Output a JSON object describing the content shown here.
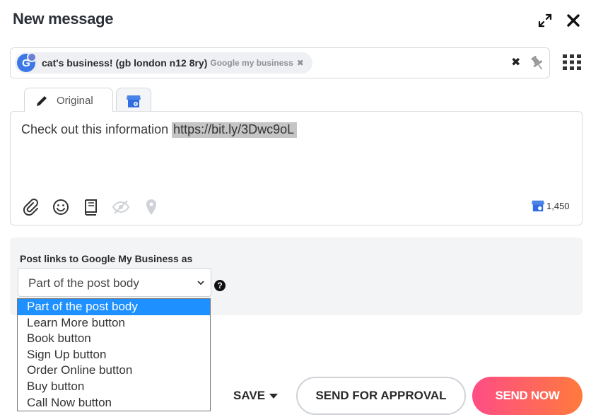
{
  "header": {
    "title": "New message",
    "icons": [
      "expand-icon",
      "close-icon"
    ]
  },
  "recipients": {
    "chips": [
      {
        "avatar_letter": "G",
        "name": "cat's business! (gb london n12 8ry)",
        "type": "Google my business",
        "remove": "✖"
      }
    ],
    "clear_all": "✖"
  },
  "tabs": [
    {
      "label": "Original",
      "icon": "pencil-icon",
      "active": true
    },
    {
      "label": "",
      "icon": "google-my-business-icon",
      "active": false
    }
  ],
  "editor": {
    "text": "Check out this information ",
    "link": "https://bit.ly/3Dwc9oL",
    "toolbar": [
      "paperclip-icon",
      "smiley-icon",
      "book-icon",
      "eye-slash-icon",
      "location-pin-icon"
    ],
    "char_count": "1,450"
  },
  "link_options": {
    "label": "Post links to Google My Business as",
    "selected": "Part of the post body",
    "options": [
      "Part of the post body",
      "Learn More button",
      "Book button",
      "Sign Up button",
      "Order Online button",
      "Buy button",
      "Call Now button"
    ],
    "help": "?"
  },
  "footer": {
    "save": "SAVE",
    "send_for_approval": "SEND FOR APPROVAL",
    "send_now": "SEND NOW"
  },
  "colors": {
    "accent_gradient_start": "#ff4d86",
    "accent_gradient_end": "#ff7a3d",
    "selection_blue": "#1e90ff",
    "google_blue": "#3c78e6"
  }
}
